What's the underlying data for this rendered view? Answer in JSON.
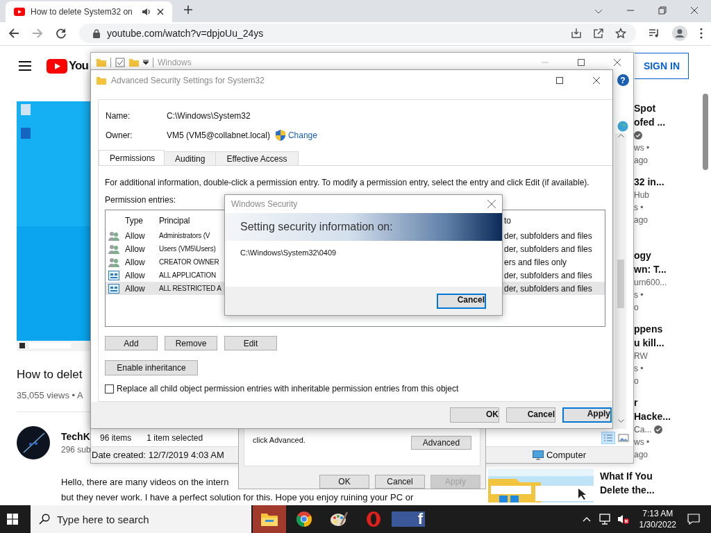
{
  "browser": {
    "tab": {
      "title": "How to delete System32 on "
    },
    "address": "youtube.com/watch?v=dpjoUu_24ys"
  },
  "youtube": {
    "logo": "You",
    "sign_in": "SIGN IN",
    "video_title": "How to delet",
    "views": "35,055 views • A",
    "channel": "TechK",
    "subscribers": "296 sub",
    "description": [
      "Hello, there are many videos on the intern",
      "but they never work. I have a perfect solution for this. Hope you enjoy ruining your PC or"
    ],
    "sidebar": [
      {
        "title_lines": [
          "Spot",
          "ofed ..."
        ],
        "verified": true,
        "meta_lines": [
          "ws •",
          "ago"
        ]
      },
      {
        "title_lines": [
          "32 in..."
        ],
        "channel": "Hub",
        "verified": false,
        "meta_lines": [
          "s •",
          "ago"
        ]
      },
      {
        "title_lines": [
          "ogy",
          "wn: T..."
        ],
        "channel": "urn600...",
        "verified": false,
        "meta_lines": [
          "s •",
          "o"
        ]
      },
      {
        "title_lines": [
          "ppens",
          "u kill..."
        ],
        "channel": "RW",
        "verified": false,
        "meta_lines": [
          "s •",
          "o"
        ]
      },
      {
        "title_lines": [
          "r",
          "Hacke..."
        ],
        "channel": "Ca...",
        "verified": true,
        "meta_lines": [
          "ws •",
          "ago"
        ]
      }
    ],
    "sidebar_last": {
      "kind": "picture",
      "title_lines": [
        "What If You",
        "Delete the..."
      ]
    }
  },
  "explorer": {
    "title": "Windows",
    "help": "?",
    "item_count": "96 items",
    "selection": "1 item selected",
    "date_created": "Date created: 12/7/2019 4:03 AM",
    "location": "Computer"
  },
  "properties": {
    "note": "click Advanced.",
    "advanced": "Advanced",
    "buttons": [
      {
        "label": "OK",
        "disabled": false
      },
      {
        "label": "Cancel",
        "disabled": false
      },
      {
        "label": "Apply",
        "disabled": true
      }
    ]
  },
  "advanced_security": {
    "title": "Advanced Security Settings for System32",
    "name_label": "Name:",
    "name": "C:\\Windows\\System32",
    "owner_label": "Owner:",
    "owner": "VM5 (VM5@collabnet.local)",
    "change": "Change",
    "tabs": [
      {
        "label": "Permissions",
        "selected": true
      },
      {
        "label": "Auditing",
        "selected": false
      },
      {
        "label": "Effective Access",
        "selected": false
      }
    ],
    "info": "For additional information, double-click a permission entry. To modify a permission entry, select the entry and click Edit (if available).",
    "entries_label": "Permission entries:",
    "columns": [
      "Type",
      "Principal",
      "to"
    ],
    "rows": [
      {
        "kind": "group",
        "type": "Allow",
        "principal": "Administrators (V",
        "applies": "der, subfolders and files",
        "selected": false
      },
      {
        "kind": "group",
        "type": "Allow",
        "principal": "Users (VM5\\Users)",
        "applies": "der, subfolders and files",
        "selected": false
      },
      {
        "kind": "group",
        "type": "Allow",
        "principal": "CREATOR OWNER",
        "applies": "ers and files only",
        "selected": false
      },
      {
        "kind": "app",
        "type": "Allow",
        "principal": "ALL APPLICATION",
        "applies": "der, subfolders and files",
        "selected": false
      },
      {
        "kind": "app",
        "type": "Allow",
        "principal": "ALL RESTRICTED A",
        "applies": "der, subfolders and files",
        "selected": true
      }
    ],
    "buttons": [
      "Add",
      "Remove",
      "Edit"
    ],
    "inheritance": "Enable inheritance",
    "replace": {
      "label": "Replace all child object permission entries with inheritable permission entries from this object",
      "checked": false
    },
    "footer": [
      {
        "label": "OK",
        "default": false
      },
      {
        "label": "Cancel",
        "default": false
      },
      {
        "label": "Apply",
        "default": true
      }
    ]
  },
  "windows_security": {
    "title": "Windows Security",
    "heading": "Setting security information on:",
    "path": "C:\\Windows\\System32\\0409",
    "cancel": "Cancel"
  },
  "taskbar": {
    "search_placeholder": "Type here to search",
    "apps": [
      {
        "kind": "explorer",
        "active": true
      },
      {
        "kind": "chrome",
        "active": false
      },
      {
        "kind": "paint",
        "active": false
      },
      {
        "kind": "opera",
        "active": false
      },
      {
        "kind": "facebook",
        "active": false,
        "glyph": "f"
      }
    ],
    "time": "7:13 AM",
    "date": "1/30/2022"
  }
}
